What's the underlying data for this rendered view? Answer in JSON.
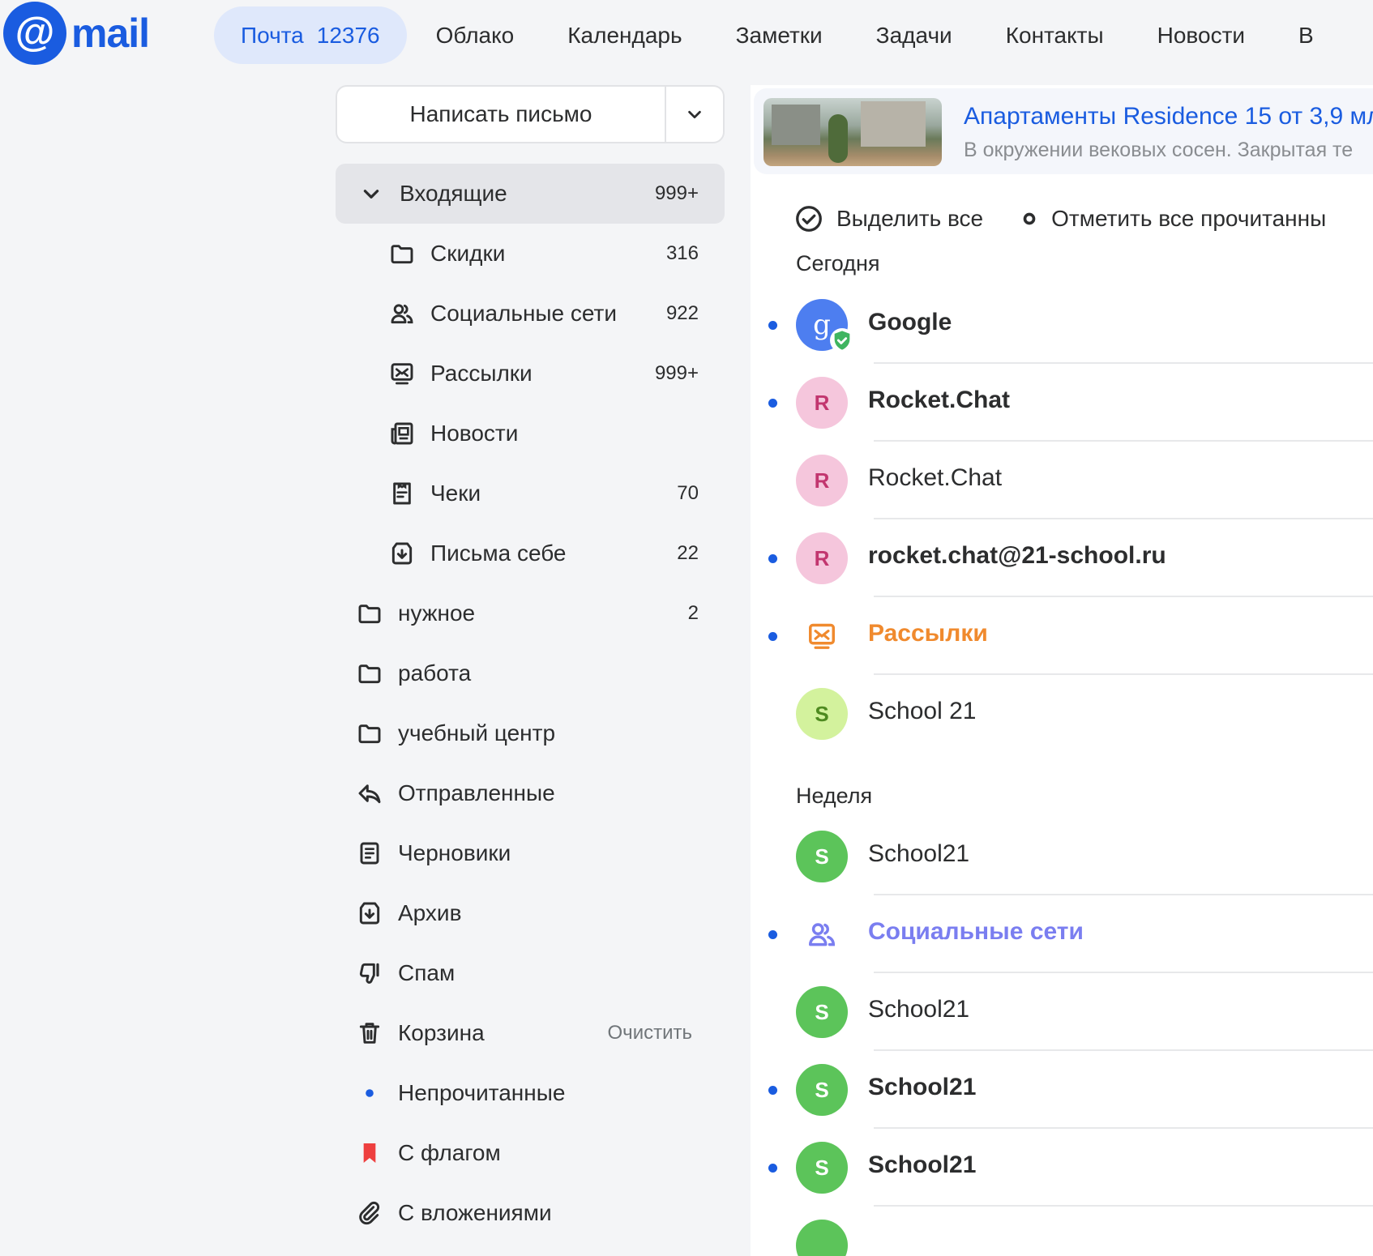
{
  "logo": {
    "at": "@",
    "text": "mail"
  },
  "nav": {
    "tabs": [
      {
        "label": "Почта",
        "count": "12376"
      },
      {
        "label": "Облако"
      },
      {
        "label": "Календарь"
      },
      {
        "label": "Заметки"
      },
      {
        "label": "Задачи"
      },
      {
        "label": "Контакты"
      },
      {
        "label": "Новости"
      },
      {
        "label": "В"
      }
    ]
  },
  "sidebar": {
    "compose_label": "Написать письмо",
    "folders": [
      {
        "label": "Входящие",
        "count": "999+"
      },
      {
        "label": "Скидки",
        "count": "316"
      },
      {
        "label": "Социальные сети",
        "count": "922"
      },
      {
        "label": "Рассылки",
        "count": "999+"
      },
      {
        "label": "Новости",
        "count": ""
      },
      {
        "label": "Чеки",
        "count": "70"
      },
      {
        "label": "Письма себе",
        "count": "22"
      },
      {
        "label": "нужное",
        "count": "2"
      },
      {
        "label": "работа",
        "count": ""
      },
      {
        "label": "учебный центр",
        "count": ""
      },
      {
        "label": "Отправленные",
        "count": ""
      },
      {
        "label": "Черновики",
        "count": ""
      },
      {
        "label": "Архив",
        "count": ""
      },
      {
        "label": "Спам",
        "count": ""
      },
      {
        "label": "Корзина",
        "action": "Очистить"
      },
      {
        "label": "Непрочитанные"
      },
      {
        "label": "С флагом"
      },
      {
        "label": "С вложениями"
      }
    ]
  },
  "ad": {
    "title": "Апартаменты Residence 15 от 3,9 мл",
    "text": "В окружении вековых сосен. Закрытая те"
  },
  "toolbar": {
    "select_all": "Выделить все",
    "mark_all_read": "Отметить все прочитанны"
  },
  "sections": {
    "today": "Сегодня",
    "week": "Неделя"
  },
  "messages": [
    {
      "sender": "Google",
      "avatar": "g"
    },
    {
      "sender": "Rocket.Chat",
      "avatar": "R"
    },
    {
      "sender": "Rocket.Chat",
      "avatar": "R"
    },
    {
      "sender": "rocket.chat@21-school.ru",
      "avatar": "R"
    },
    {
      "sender": "Рассылки"
    },
    {
      "sender": "School 21",
      "avatar": "S"
    },
    {
      "sender": "School21",
      "avatar": "S"
    },
    {
      "sender": "Социальные сети"
    },
    {
      "sender": "School21",
      "avatar": "S"
    },
    {
      "sender": "School21",
      "avatar": "S"
    },
    {
      "sender": "School21",
      "avatar": "S"
    }
  ],
  "colors": {
    "accent": "#1a5ce0",
    "newsletters": "#f08a2e",
    "social": "#7a7ef0",
    "flag": "#ee3f3f"
  }
}
